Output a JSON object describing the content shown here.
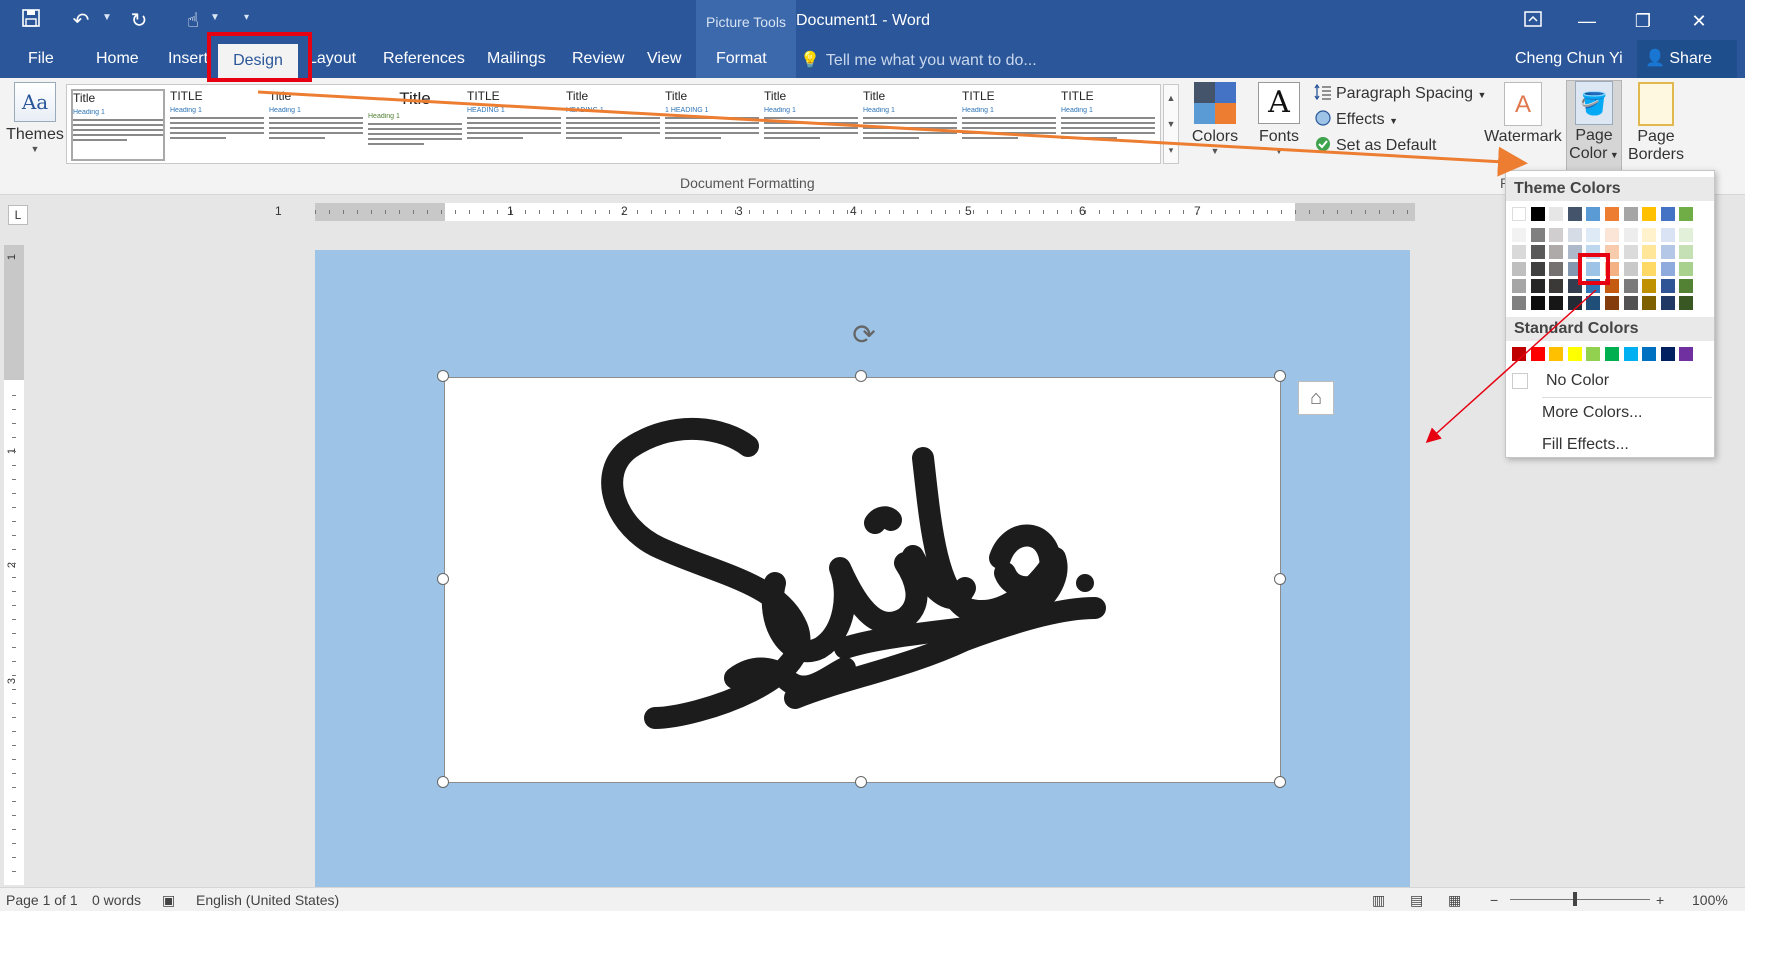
{
  "title_bar": {
    "picture_tools": "Picture Tools",
    "document_title": "Document1 - Word"
  },
  "tabs": {
    "file": "File",
    "home": "Home",
    "insert": "Insert",
    "design": "Design",
    "layout": "Layout",
    "references": "References",
    "mailings": "Mailings",
    "review": "Review",
    "view": "View",
    "format": "Format"
  },
  "tell_me": {
    "placeholder": "Tell me what you want to do..."
  },
  "user": {
    "name": "Cheng Chun Yi",
    "share": "Share"
  },
  "ribbon": {
    "themes": "Themes",
    "colors": "Colors",
    "fonts": "Fonts",
    "fonts_glyph": "A",
    "themes_glyph": "Aa",
    "paragraph_spacing": "Paragraph Spacing",
    "effects": "Effects",
    "set_as_default": "Set as Default",
    "watermark": "Watermark",
    "page_color_line1": "Page",
    "page_color_line2": "Color",
    "page_borders_line1": "Page",
    "page_borders_line2": "Borders",
    "group_document_formatting": "Document Formatting",
    "group_page_bg_partial": "Pag",
    "style_gallery": [
      {
        "title": "Title",
        "heading": "Heading 1"
      },
      {
        "title": "TITLE",
        "heading": "Heading 1"
      },
      {
        "title": "Title",
        "heading": "Heading 1"
      },
      {
        "title": "Title",
        "heading": "Heading 1"
      },
      {
        "title": "TITLE",
        "heading": "HEADING 1"
      },
      {
        "title": "Title",
        "heading": "HEADING 1"
      },
      {
        "title": "Title",
        "heading": "1 HEADING 1"
      },
      {
        "title": "Title",
        "heading": "Heading 1"
      },
      {
        "title": "Title",
        "heading": "Heading 1"
      },
      {
        "title": "TITLE",
        "heading": "Heading 1"
      },
      {
        "title": "TITLE",
        "heading": "Heading 1"
      }
    ]
  },
  "ruler": {
    "numbers": [
      "1",
      "1",
      "2",
      "3",
      "4",
      "5",
      "6",
      "7"
    ]
  },
  "vertical_ruler": {
    "numbers": [
      "1",
      "1",
      "2",
      "3"
    ]
  },
  "page_color_menu": {
    "theme_colors_header": "Theme Colors",
    "standard_colors_header": "Standard Colors",
    "no_color": "No Color",
    "more_colors": "More Colors...",
    "fill_effects": "Fill Effects...",
    "theme_columns": [
      [
        "#ffffff",
        "#f2f2f2",
        "#d9d9d9",
        "#bfbfbf",
        "#a6a6a6",
        "#808080"
      ],
      [
        "#000000",
        "#808080",
        "#595959",
        "#404040",
        "#262626",
        "#0d0d0d"
      ],
      [
        "#e7e6e6",
        "#d0cece",
        "#aeaaaa",
        "#757171",
        "#3b3838",
        "#171616"
      ],
      [
        "#44546a",
        "#d6dce5",
        "#adb9ca",
        "#8497b0",
        "#333f50",
        "#222a35"
      ],
      [
        "#5b9bd5",
        "#deebf7",
        "#bdd7ee",
        "#9dc3e6",
        "#2e75b6",
        "#1f4e79"
      ],
      [
        "#ed7d31",
        "#fbe5d6",
        "#f8cbad",
        "#f4b183",
        "#c55a11",
        "#843c0c"
      ],
      [
        "#a5a5a5",
        "#ededed",
        "#dbdbdb",
        "#c9c9c9",
        "#7b7b7b",
        "#525252"
      ],
      [
        "#ffc000",
        "#fff2cc",
        "#ffe699",
        "#ffd966",
        "#bf9000",
        "#7f6000"
      ],
      [
        "#4472c4",
        "#dae3f3",
        "#b4c7e7",
        "#8faadc",
        "#2f5597",
        "#203864"
      ],
      [
        "#70ad47",
        "#e2f0d9",
        "#c5e0b4",
        "#a9d18e",
        "#548235",
        "#385723"
      ]
    ],
    "standard_colors": [
      "#c00000",
      "#ff0000",
      "#ffc000",
      "#ffff00",
      "#92d050",
      "#00b050",
      "#00b0f0",
      "#0070c0",
      "#002060",
      "#7030a0"
    ]
  },
  "document": {
    "page_background": "#9dc3e6"
  },
  "status_bar": {
    "page": "Page 1 of 1",
    "words": "0 words",
    "language": "English (United States)",
    "zoom": "100%"
  },
  "colors": {
    "title_bar": "#2b579a",
    "annotation_red": "#e60012",
    "annotation_orange": "#ed7d31"
  }
}
